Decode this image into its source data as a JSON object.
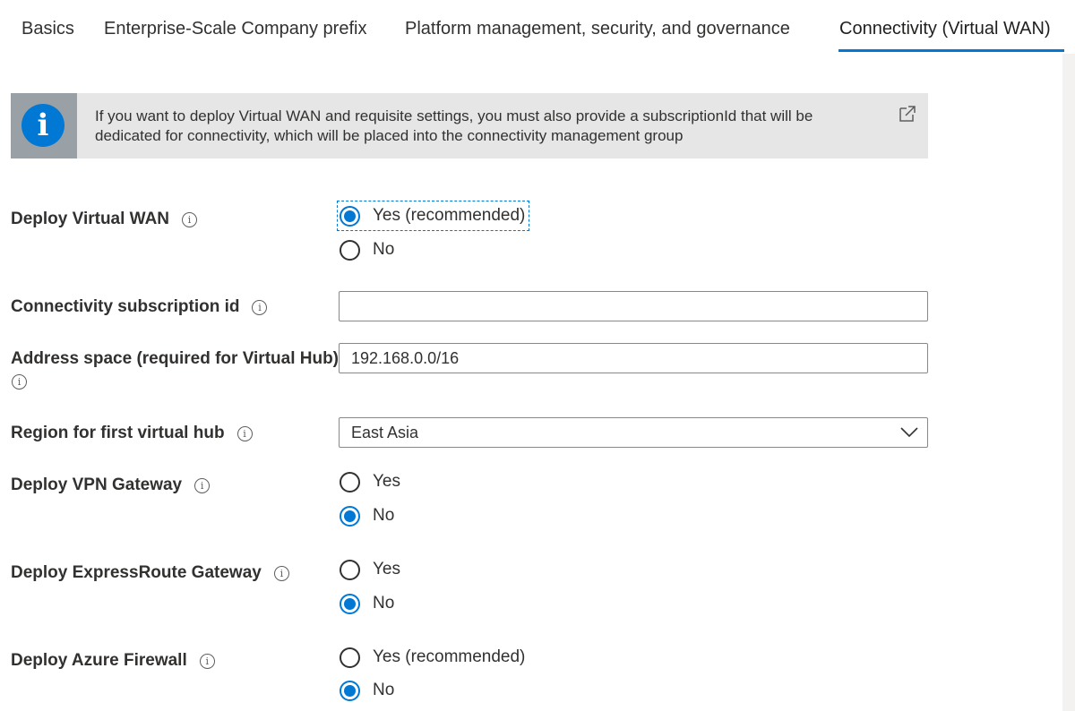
{
  "tabs": [
    {
      "label": "Basics"
    },
    {
      "label": "Enterprise-Scale Company prefix"
    },
    {
      "label": "Platform management, security, and governance"
    },
    {
      "label": "Connectivity (Virtual WAN)"
    }
  ],
  "active_tab": "Connectivity (Virtual WAN)",
  "info_bar": {
    "icon": "info-icon",
    "text": "If you want to deploy Virtual WAN and requisite settings, you must also provide a subscriptionId that will be dedicated for connectivity, which will be placed into the connectivity management group",
    "link_icon": "external-link-icon"
  },
  "form": {
    "deploy_vwan": {
      "label": "Deploy Virtual WAN",
      "options": [
        "Yes (recommended)",
        "No"
      ],
      "selected": "Yes (recommended)"
    },
    "conn_sub": {
      "label": "Connectivity subscription id",
      "value": ""
    },
    "address_space": {
      "label": "Address space (required for Virtual Hub)",
      "value": "192.168.0.0/16"
    },
    "region": {
      "label": "Region for first virtual hub",
      "value": "East Asia"
    },
    "vpn_gw": {
      "label": "Deploy VPN Gateway",
      "options": [
        "Yes",
        "No"
      ],
      "selected": "No"
    },
    "er_gw": {
      "label": "Deploy ExpressRoute Gateway",
      "options": [
        "Yes",
        "No"
      ],
      "selected": "No"
    },
    "firewall": {
      "label": "Deploy Azure Firewall",
      "options": [
        "Yes (recommended)",
        "No"
      ],
      "selected": "No"
    }
  },
  "colors": {
    "accent": "#0078d4",
    "info_bar_bg": "#e6e6e6",
    "info_icon_bg": "#99a0a6",
    "text": "#323130"
  }
}
